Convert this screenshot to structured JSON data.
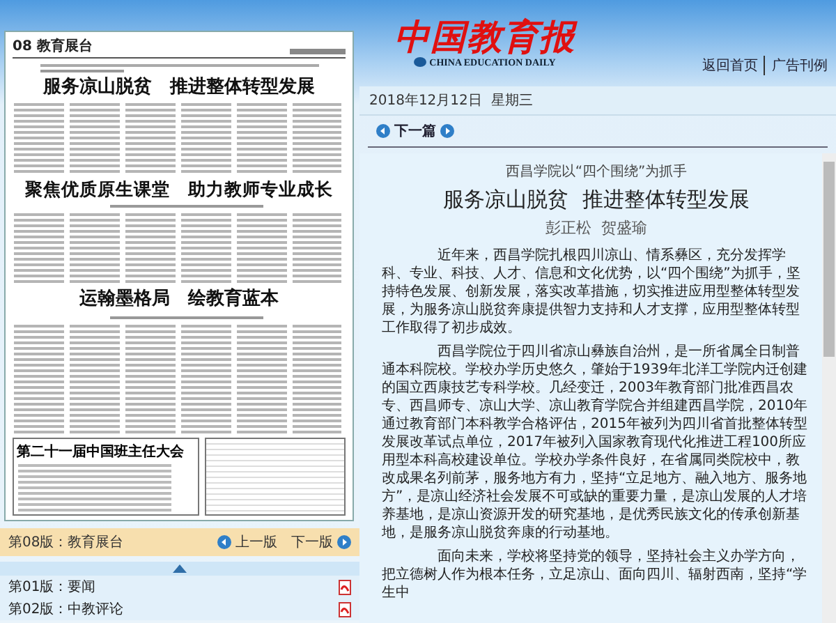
{
  "header": {
    "logo_cn": "中国教育报",
    "logo_en": "CHINA EDUCATION DAILY",
    "links": [
      "返回首页",
      "广告刊例"
    ]
  },
  "date": "2018年12月12日  星期三",
  "article_nav": {
    "next": "下一篇"
  },
  "newspaper_page": {
    "page_label": "08 教育展台",
    "headlines": [
      "服务凉山脱贫　推进整体转型发展",
      "聚焦优质原生课堂　助力教师专业成长",
      "运翰墨格局　绘教育蓝本"
    ],
    "box_title": "第二十一届中国班主任大会"
  },
  "page_bar": {
    "current": "第08版：教育展台",
    "prev": "上一版",
    "next": "下一版"
  },
  "page_list": [
    {
      "label": "第01版：要闻"
    },
    {
      "label": "第02版：中教评论"
    }
  ],
  "article": {
    "kicker": "西昌学院以“四个围绕”为抓手",
    "title": "服务凉山脱贫  推进整体转型发展",
    "authors": "彭正松  贺盛瑜",
    "paragraphs": [
      "近年来，西昌学院扎根四川凉山、情系彝区，充分发挥学科、专业、科技、人才、信息和文化优势，以“四个围绕”为抓手，坚持特色发展、创新发展，落实改革措施，切实推进应用型整体转型发展，为服务凉山脱贫奔康提供智力支持和人才支撑，应用型整体转型工作取得了初步成效。",
      "西昌学院位于四川省凉山彝族自治州，是一所省属全日制普通本科院校。学校办学历史悠久，肇始于1939年北洋工学院内迁创建的国立西康技艺专科学校。几经变迁，2003年教育部门批准西昌农专、西昌师专、凉山大学、凉山教育学院合并组建西昌学院，2010年通过教育部门本科教学合格评估，2015年被列为四川省首批整体转型发展改革试点单位，2017年被列入国家教育现代化推进工程100所应用型本科高校建设单位。学校办学条件良好，在省属同类院校中，教改成果名列前茅，服务地方有力，坚持“立足地方、融入地方、服务地方”，是凉山经济社会发展不可或缺的重要力量，是凉山发展的人才培养基地，是凉山资源开发的研究基地，是优秀民族文化的传承创新基地，是服务凉山脱贫奔康的行动基地。",
      "面向未来，学校将坚持党的领导，坚持社会主义办学方向，把立德树人作为根本任务，立足凉山、面向四川、辐射西南，坚持“学生中"
    ]
  }
}
